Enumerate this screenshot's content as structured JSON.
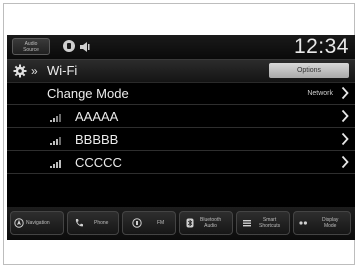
{
  "status_bar": {
    "audio_source_line1": "Audio",
    "audio_source_line2": "Source",
    "clock": "12:34"
  },
  "title_bar": {
    "title": "Wi-Fi",
    "options_label": "Options",
    "icons": [
      "gear-icon",
      "breadcrumb-arrow-icon"
    ]
  },
  "list": {
    "change_mode": {
      "label": "Change Mode",
      "value": "Network"
    },
    "networks": [
      {
        "ssid": "AAAAA",
        "icon": "wifi-signal-icon"
      },
      {
        "ssid": "BBBBB",
        "icon": "wifi-signal-icon"
      },
      {
        "ssid": "CCCCC",
        "icon": "wifi-signal-icon"
      }
    ]
  },
  "bottom_bar": {
    "navigation": "Navigation",
    "phone": "Phone",
    "fm": "FM",
    "bluetooth_audio_line1": "Bluetooth",
    "bluetooth_audio_line2": "Audio",
    "smart_shortcuts_line1": "Smart",
    "smart_shortcuts_line2": "Shortcuts",
    "display_mode_line1": "Display",
    "display_mode_line2": "Mode"
  },
  "colors": {
    "screen_background": "#000000",
    "text": "#ececec",
    "options_button": "#c4c4c4"
  }
}
